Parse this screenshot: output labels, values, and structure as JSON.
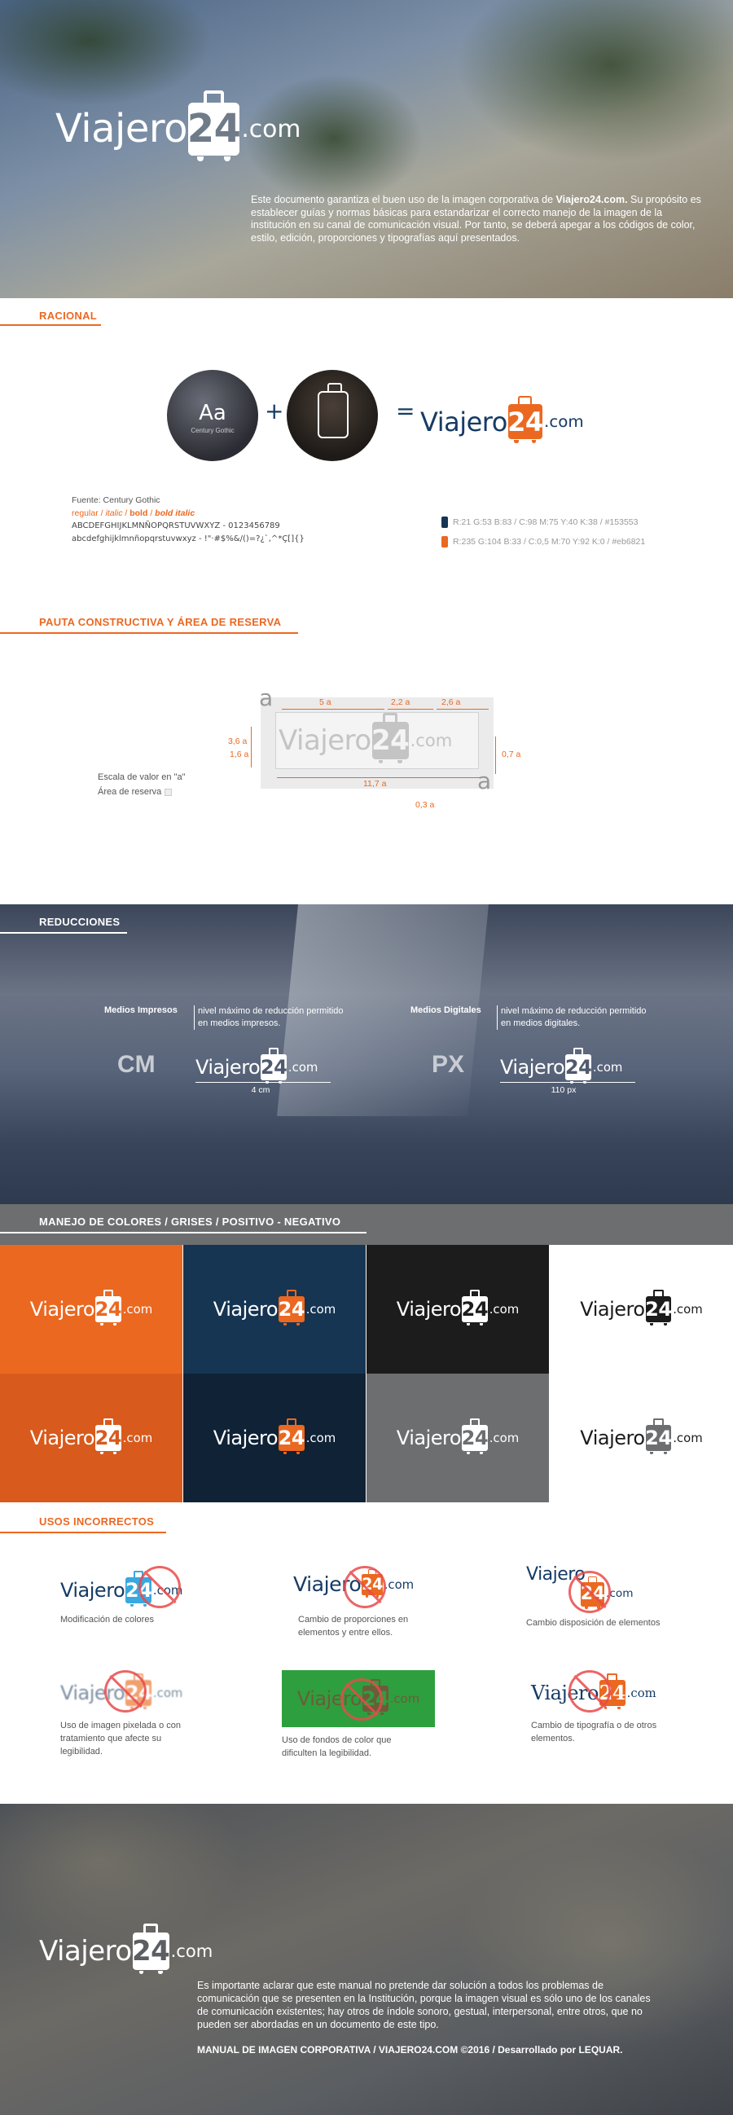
{
  "brand": {
    "word": "Viajero",
    "number": "24",
    "tld": ".com"
  },
  "colors": {
    "orange": "#eb6821",
    "navy": "#153553",
    "navy_dark": "#0f2236",
    "black": "#1c1c1c",
    "gray": "#6d6e70",
    "white": "#ffffff",
    "orange_dark": "#d85a1c",
    "light_gray": "#9a9a9a"
  },
  "hero": {
    "intro_pre": "Este documento garantiza el buen uso de la imagen corporativa de ",
    "intro_bold": "Viajero24.com.",
    "intro_rest": "Su propósito es establecer guías y normas básicas para estandarizar el correcto manejo de la imagen de la institución en su canal de comunicación visual. Por tanto, se deberá apegar a los códigos de color, estilo, edición, proporciones y tipografías aquí presentados."
  },
  "racional": {
    "title": "RACIONAL",
    "circle_text": "Aa",
    "circle_caption": "Century Gothic",
    "plus": "+",
    "equals": "=",
    "font_source": "Fuente: Century Gothic",
    "styles_regular": "regular",
    "styles_sep": " / ",
    "styles_italic": "italic",
    "styles_bold": "bold",
    "styles_bold_italic": "bold italic",
    "uppercase": "ABCDEFGHIJKLMNÑOPQRSTUVWXYZ - 0123456789",
    "lowercase": "abcdefghijklmnñopqrstuvwxyz - !\"·#$%&/()=?¿`,^*Ç[]{}",
    "color1_text": "R:21 G:53 B:83 / C:98 M:75 Y:40 K:38 / #153553",
    "color2_text": "R:235 G:104 B:33 / C:0,5 M:70 Y:92 K:0 / #eb6821"
  },
  "pauta": {
    "title": "PAUTA CONSTRUCTIVA Y ÁREA DE RESERVA",
    "unit_glyph": "a",
    "dim_5a": "5 a",
    "dim_2_2a": "2,2 a",
    "dim_2_6a": "2,6 a",
    "dim_3_6a": "3,6 a",
    "dim_1_6a": "1,6 a",
    "dim_0_7a": "0,7 a",
    "dim_11_7a": "11,7 a",
    "dim_0_3a": "0,3 a",
    "legend_scale": "Escala de valor en \"a\"",
    "legend_reserve": "Área de reserva"
  },
  "reducciones": {
    "title": "REDUCCIONES",
    "print_label": "Medios Impresos",
    "print_desc": "nivel máximo de reducción permitido en medios impresos.",
    "print_unit": "CM",
    "print_size": "4 cm",
    "digital_label": "Medios Digitales",
    "digital_desc": "nivel máximo de reducción permitido en medios digitales.",
    "digital_unit": "PX",
    "digital_size": "110 px"
  },
  "colores": {
    "title": "MANEJO DE COLORES / GRISES / POSITIVO - NEGATIVO"
  },
  "usos": {
    "title": "USOS INCORRECTOS",
    "items": [
      {
        "caption": "Modificación de colores"
      },
      {
        "caption": "Cambio de proporciones en elementos y entre ellos."
      },
      {
        "caption": "Cambio disposición de elementos"
      },
      {
        "caption": "Uso de imagen pixelada o con tratamiento que afecte su legibilidad."
      },
      {
        "caption": "Uso de fondos de color que dificulten la legibilidad."
      },
      {
        "caption": "Cambio de tipografía o de otros elementos."
      }
    ]
  },
  "footer": {
    "text": "Es importante aclarar que este manual no pretende dar solución a todos los problemas de comunicación que se presenten en la Institución, porque la imagen visual es sólo uno de los canales de comunicación existentes; hay otros de índole sonoro, gestual, interpersonal, entre otros, que no pueden ser abordadas en un documento de este tipo.",
    "credit": "MANUAL DE IMAGEN CORPORATIVA / VIAJERO24.COM ©2016 / Desarrollado por LEQUAR."
  }
}
